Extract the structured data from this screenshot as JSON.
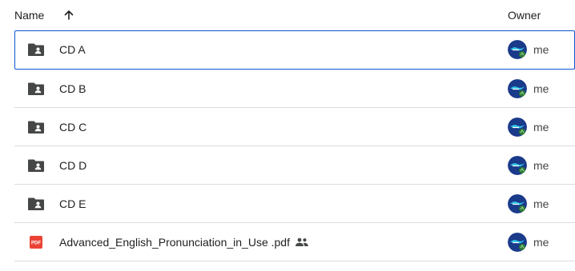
{
  "header": {
    "name_label": "Name",
    "sort_icon": "arrow-up-icon",
    "owner_label": "Owner"
  },
  "rows": [
    {
      "name": "CD A",
      "type": "folder",
      "icon": "shared-folder-icon",
      "owner": "me",
      "selected": true,
      "shared": false
    },
    {
      "name": "CD B",
      "type": "folder",
      "icon": "shared-folder-icon",
      "owner": "me",
      "selected": false,
      "shared": false
    },
    {
      "name": "CD C",
      "type": "folder",
      "icon": "shared-folder-icon",
      "owner": "me",
      "selected": false,
      "shared": false
    },
    {
      "name": "CD D",
      "type": "folder",
      "icon": "shared-folder-icon",
      "owner": "me",
      "selected": false,
      "shared": false
    },
    {
      "name": "CD E",
      "type": "folder",
      "icon": "shared-folder-icon",
      "owner": "me",
      "selected": false,
      "shared": false
    },
    {
      "name": "Advanced_English_Pronunciation_in_Use .pdf",
      "type": "pdf",
      "icon": "pdf-icon",
      "pdf_badge": "PDF",
      "owner": "me",
      "selected": false,
      "shared": true,
      "shared_icon": "people-icon"
    }
  ],
  "colors": {
    "selected_border": "#0b57d0",
    "divider": "#dadce0",
    "folder_icon": "#444746",
    "pdf_red": "#ea4335",
    "avatar_bg": "#1a3a8a"
  }
}
